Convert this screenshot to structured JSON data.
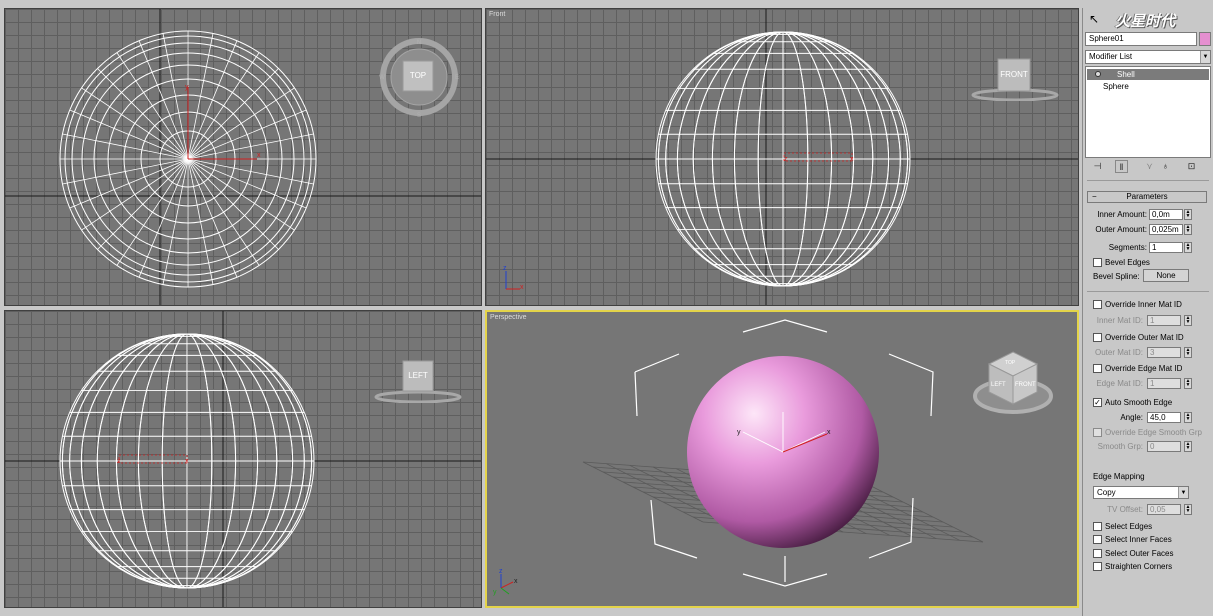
{
  "viewports": {
    "top": {
      "label": ""
    },
    "front": {
      "label": "Front"
    },
    "left": {
      "label": ""
    },
    "perspective": {
      "label": "Perspective"
    }
  },
  "viewcube": {
    "top": "TOP",
    "front": "FRONT",
    "left": "LEFT",
    "persp_top": "TOP",
    "persp_left": "LEFT",
    "persp_front": "FRONT"
  },
  "colors": {
    "sphere_pink": "#e38fd3",
    "active_border": "#e4d44a",
    "viewport_bg": "#767676"
  },
  "panel": {
    "watermark": "火星时代",
    "object_name": "Sphere01",
    "object_color": "#e58fd0",
    "modifier_list": "Modifier List",
    "stack": [
      "Shell",
      "Sphere"
    ],
    "parameters": {
      "title": "Parameters",
      "inner_amount_label": "Inner Amount:",
      "inner_amount": "0,0m",
      "outer_amount_label": "Outer Amount:",
      "outer_amount": "0,025m",
      "segments_label": "Segments:",
      "segments": "1",
      "bevel_edges": "Bevel Edges",
      "bevel_spline_label": "Bevel Spline:",
      "bevel_spline_value": "None",
      "override_inner": "Override Inner Mat ID",
      "inner_mat_label": "Inner Mat ID:",
      "inner_mat": "1",
      "override_outer": "Override Outer Mat ID",
      "outer_mat_label": "Outer Mat ID:",
      "outer_mat": "3",
      "override_edge": "Override Edge Mat ID",
      "edge_mat_label": "Edge Mat ID:",
      "edge_mat": "1",
      "auto_smooth": "Auto Smooth Edge",
      "auto_smooth_checked": true,
      "angle_label": "Angle:",
      "angle": "45,0",
      "override_smooth": "Override Edge Smooth Grp",
      "smooth_grp_label": "Smooth Grp:",
      "smooth_grp": "0",
      "edge_mapping_label": "Edge Mapping",
      "edge_mapping": "Copy",
      "tv_offset_label": "TV Offset:",
      "tv_offset": "0,05",
      "select_edges": "Select Edges",
      "select_inner": "Select Inner Faces",
      "select_outer": "Select Outer Faces",
      "straighten": "Straighten Corners"
    }
  }
}
